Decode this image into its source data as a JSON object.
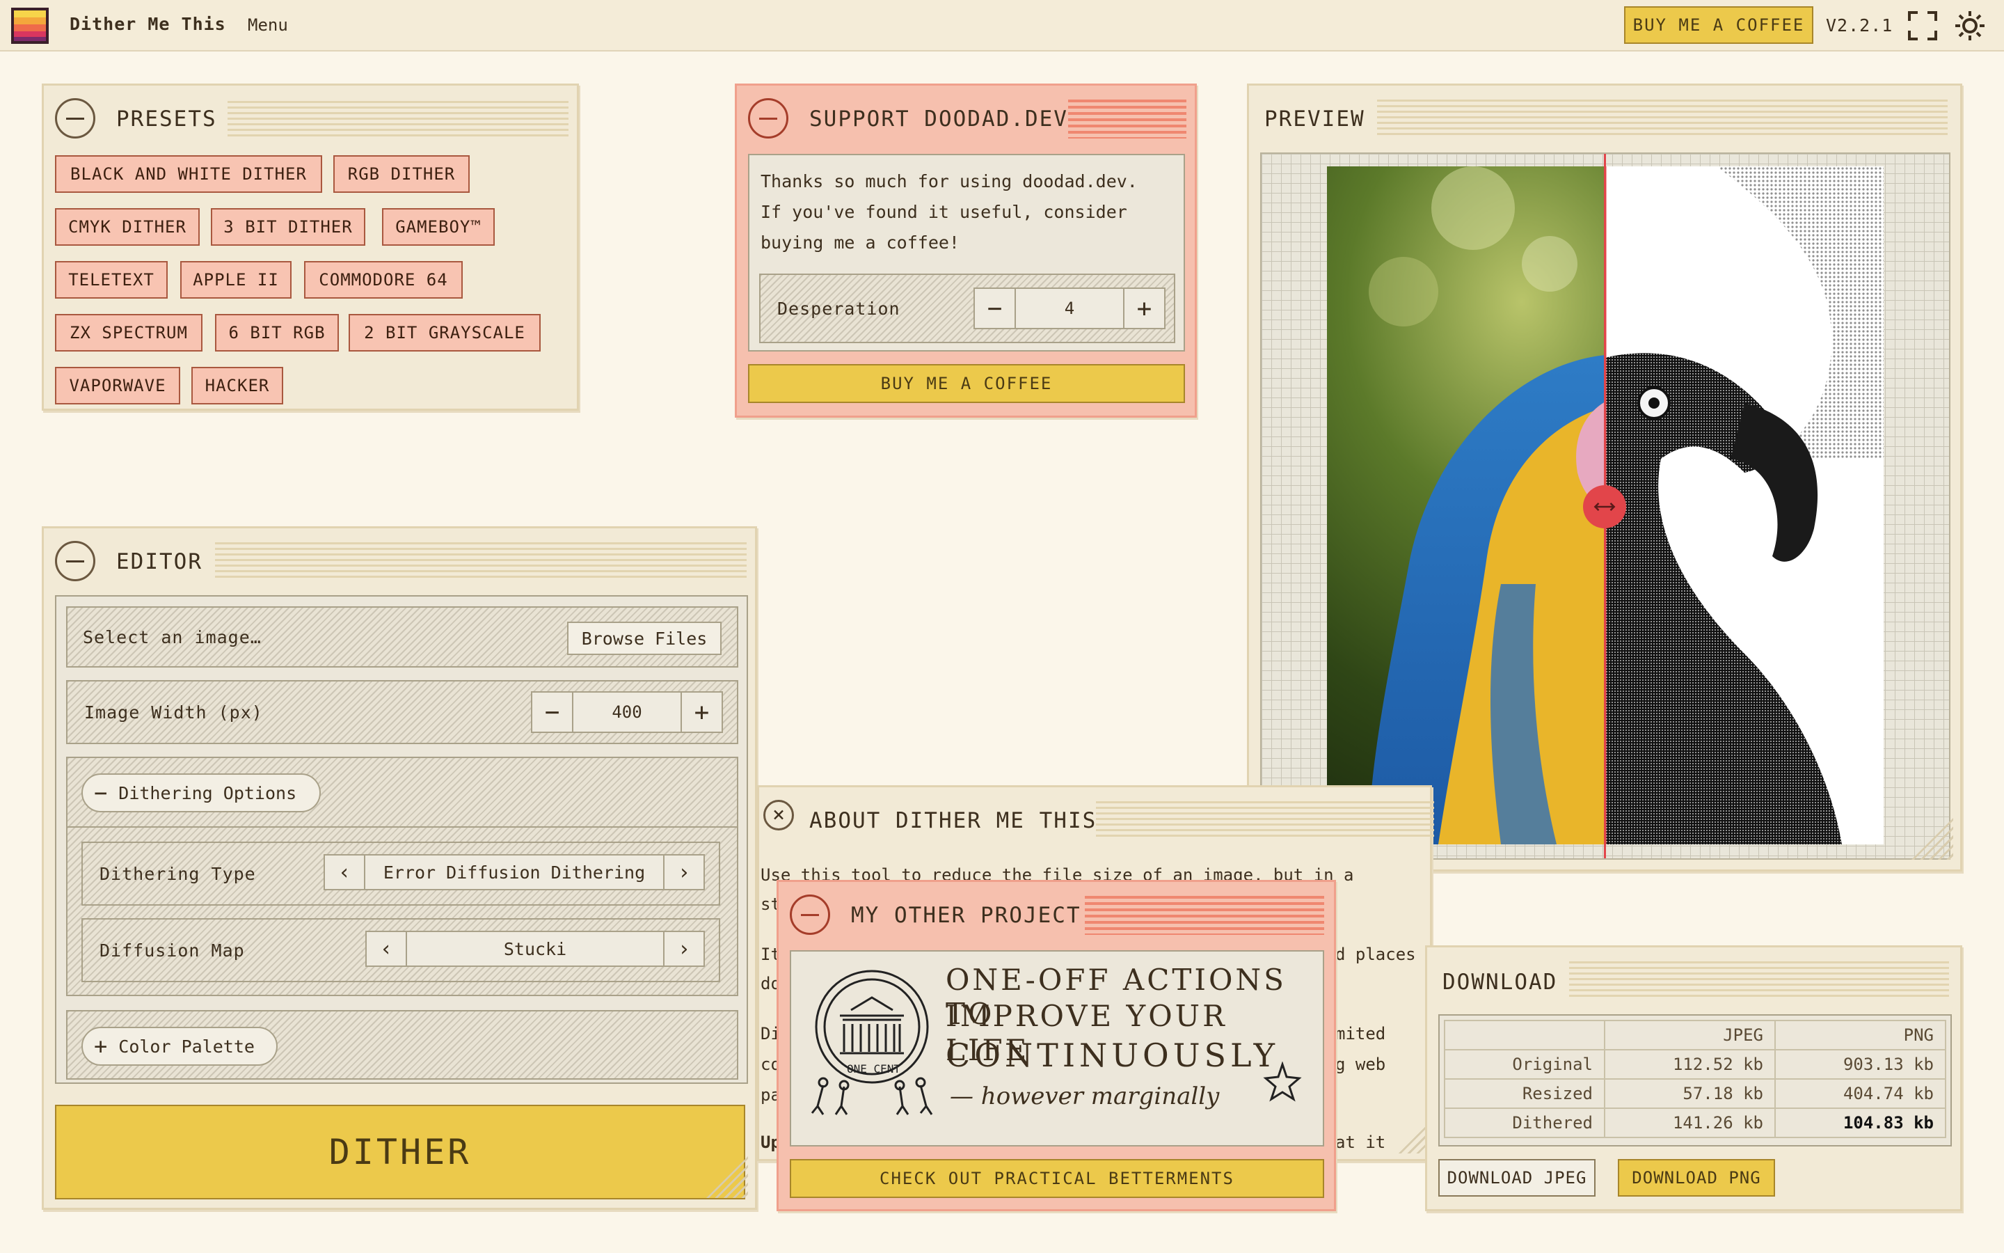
{
  "app": {
    "title": "Dither Me This",
    "menu": "Menu",
    "buy_coffee": "BUY ME A COFFEE",
    "version": "V2.2.1"
  },
  "colors": {
    "background": "#fbf6ea",
    "panel": "#f2ead6",
    "pink_panel": "#f6c0ae",
    "accent_yellow": "#ecc94b",
    "slider_red": "#e2454a"
  },
  "icons": {
    "logo": "app-logo-icon",
    "fullscreen": "fullscreen-icon",
    "theme": "sun-icon",
    "compare": "compare-handle-icon"
  },
  "presets": {
    "title": "PRESETS",
    "items": [
      "BLACK AND WHITE DITHER",
      "RGB DITHER",
      "CMYK DITHER",
      "3 BIT DITHER",
      "GAMEBOY™",
      "TELETEXT",
      "APPLE II",
      "COMMODORE 64",
      "ZX SPECTRUM",
      "6 BIT RGB",
      "2 BIT GRAYSCALE",
      "VAPORWAVE",
      "HACKER"
    ]
  },
  "support": {
    "title": "SUPPORT DOODAD.DEV",
    "lines": [
      "Thanks so much for using doodad.dev.",
      "If you've found it useful, consider",
      "buying me a coffee!"
    ],
    "desperation_label": "Desperation",
    "desperation_value": "4",
    "button": "BUY ME A COFFEE"
  },
  "preview": {
    "title": "PREVIEW",
    "split_fraction": 0.5
  },
  "editor": {
    "title": "EDITOR",
    "select_image": "Select an image…",
    "browse": "Browse Files",
    "width_label": "Image Width (px)",
    "width_value": "400",
    "dithering_options": "Dithering Options",
    "dithering_type_label": "Dithering Type",
    "dithering_type_value": "Error Diffusion Dithering",
    "diffusion_map_label": "Diffusion Map",
    "diffusion_map_value": "Stucki",
    "color_palette": "Color Palette",
    "dither_button": "DITHER"
  },
  "about": {
    "title": "ABOUT DITHER ME THIS",
    "line1": "Use this tool to reduce the file size of an image, but in a",
    "frag_st": "st",
    "frag_it": "It",
    "frag_places": "d places",
    "frag_do": "do",
    "frag_di": "Di",
    "frag_mited": "mited",
    "frag_co": "co",
    "frag_web": "g web",
    "frag_pa": "pa",
    "frag_up": "Up",
    "frag_at": "at it"
  },
  "other_project": {
    "title": "MY OTHER PROJECT",
    "banner_line1": "ONE-OFF ACTIONS TO",
    "banner_line2": "IMPROVE YOUR LIFE",
    "banner_line3": "CONTINUOUSLY",
    "banner_line4": "— however marginally",
    "coin_text": "ONE CENT",
    "button": "CHECK OUT PRACTICAL BETTERMENTS"
  },
  "download": {
    "title": "DOWNLOAD",
    "columns": [
      "JPEG",
      "PNG"
    ],
    "rows": [
      {
        "label": "Original",
        "jpeg": "112.52 kb",
        "png": "903.13 kb"
      },
      {
        "label": "Resized",
        "jpeg": "57.18 kb",
        "png": "404.74 kb"
      },
      {
        "label": "Dithered",
        "jpeg": "141.26 kb",
        "png": "104.83 kb"
      }
    ],
    "btn_jpeg": "DOWNLOAD JPEG",
    "btn_png": "DOWNLOAD PNG"
  }
}
